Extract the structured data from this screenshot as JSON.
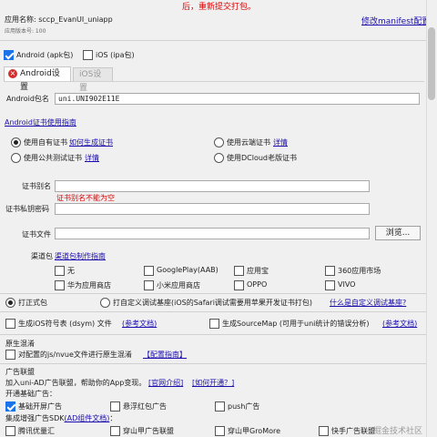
{
  "header": {
    "notice": "后，重新提交打包。",
    "app_name_label": "应用名称: sccp_EvanUI_uniapp",
    "version_label": "应用版本号: 100",
    "modify_manifest": "修改manifest配置"
  },
  "platforms": {
    "android_label": "Android (apk包)",
    "ios_label": "iOS (ipa包)"
  },
  "tabs": {
    "android": "Android设置",
    "ios": "iOS设置"
  },
  "android": {
    "package_label": "Android包名",
    "package_value": "uni.UNI902E11E",
    "cert_guide": "Android证书使用指南",
    "radio_own": "使用自有证书",
    "radio_own_link": "如何生成证书",
    "radio_cloud": "使用云端证书",
    "radio_cloud_link": "详情",
    "radio_public": "使用公共测试证书",
    "radio_public_link": "详情",
    "radio_dcloud": "使用DCloud老版证书",
    "alias_label": "证书别名",
    "alias_error": "证书别名不能为空",
    "private_pwd_label": "证书私钥密码",
    "cert_file_label": "证书文件",
    "browse_button": "浏览..."
  },
  "channels": {
    "label": "渠道包",
    "guide": "渠道包制作指南",
    "items": [
      "无",
      "GooglePlay(AAB)",
      "应用宝",
      "360应用市场",
      "华为应用商店",
      "小米应用商店",
      "OPPO",
      "VIVO"
    ]
  },
  "package_type": {
    "formal": "打正式包",
    "custom_base": "打自定义调试基座(iOS的Safari调试需要用苹果开发证书打包)",
    "custom_base_link": "什么是自定义调试基座?"
  },
  "options": {
    "ios_symbol": "生成iOS符号表 (dsym) 文件",
    "ios_symbol_link": "(参考文档)",
    "sourcemap": "生成SourceMap (可用于uni统计的错误分析)",
    "sourcemap_link": "(参考文档)"
  },
  "obfuscation": {
    "title": "原生混淆",
    "label": "对配置的js/nvue文件进行原生混淆",
    "link": "【配置指南】"
  },
  "ads": {
    "title": "广告联盟",
    "join_text": "加入uni-AD广告联盟，帮助你的App变现。",
    "official_intro": "[官网介绍]",
    "how_to_open": "[如何开通？]",
    "basic_ads_label": "开通基础广告：",
    "basic_items": [
      "基础开屏广告",
      "悬浮红包广告",
      "push广告"
    ],
    "enhanced_label": "集成增强广告SDK",
    "enhanced_link": "(AD组件文档)",
    "enhanced_suffix": "：",
    "enhanced_items": [
      "腾讯优量汇",
      "穿山甲广告联盟",
      "穿山甲GroMore",
      "快手广告联盟"
    ]
  },
  "watermark": "掘金技术社区"
}
